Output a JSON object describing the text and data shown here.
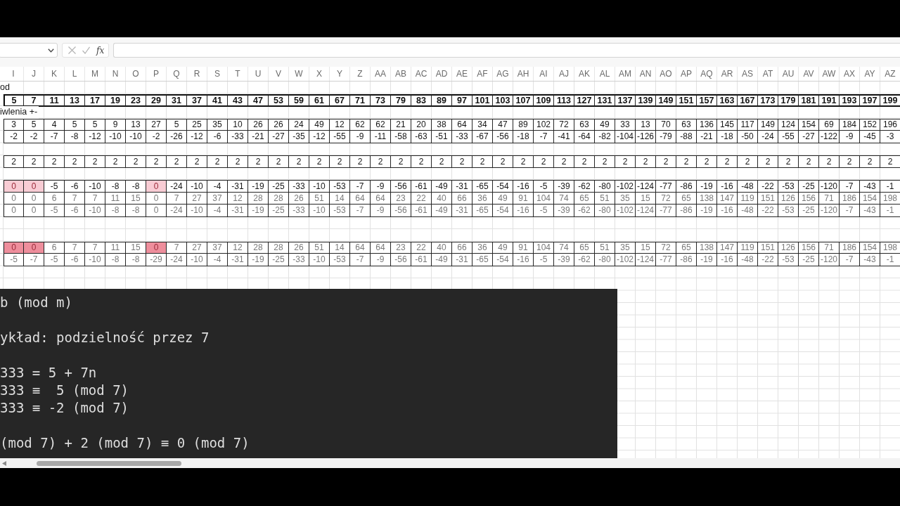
{
  "formula_bar": {
    "function_label": "fx"
  },
  "columns": [
    "I",
    "J",
    "K",
    "L",
    "M",
    "N",
    "O",
    "P",
    "Q",
    "R",
    "S",
    "T",
    "U",
    "V",
    "W",
    "X",
    "Y",
    "Z",
    "AA",
    "AB",
    "AC",
    "AD",
    "AE",
    "AF",
    "AG",
    "AH",
    "AI",
    "AJ",
    "AK",
    "AL",
    "AM",
    "AN",
    "AO",
    "AP",
    "AQ",
    "AR",
    "AS",
    "AT",
    "AU",
    "AV",
    "AW",
    "AX",
    "AY",
    "AZ"
  ],
  "rows": [
    {
      "kind": "label",
      "text": "od"
    },
    {
      "kind": "header",
      "cells": [
        "5",
        "7",
        "11",
        "13",
        "17",
        "19",
        "23",
        "29",
        "31",
        "37",
        "41",
        "43",
        "47",
        "53",
        "59",
        "61",
        "67",
        "71",
        "73",
        "79",
        "83",
        "89",
        "97",
        "101",
        "103",
        "107",
        "109",
        "113",
        "127",
        "131",
        "137",
        "139",
        "149",
        "151",
        "157",
        "163",
        "167",
        "173",
        "179",
        "181",
        "191",
        "193",
        "197",
        "199"
      ]
    },
    {
      "kind": "label",
      "text": "iwlenia +-"
    },
    {
      "kind": "values",
      "cells": [
        "3",
        "5",
        "4",
        "5",
        "5",
        "9",
        "13",
        "27",
        "5",
        "25",
        "35",
        "10",
        "26",
        "26",
        "24",
        "49",
        "12",
        "62",
        "62",
        "21",
        "20",
        "38",
        "64",
        "34",
        "47",
        "89",
        "102",
        "72",
        "63",
        "49",
        "33",
        "13",
        "70",
        "63",
        "136",
        "145",
        "117",
        "149",
        "124",
        "154",
        "69",
        "184",
        "152",
        "196"
      ]
    },
    {
      "kind": "values",
      "cells": [
        "-2",
        "-2",
        "-7",
        "-8",
        "-12",
        "-10",
        "-10",
        "-2",
        "-26",
        "-12",
        "-6",
        "-33",
        "-21",
        "-27",
        "-35",
        "-12",
        "-55",
        "-9",
        "-11",
        "-58",
        "-63",
        "-51",
        "-33",
        "-67",
        "-56",
        "-18",
        "-7",
        "-41",
        "-64",
        "-82",
        "-104",
        "-126",
        "-79",
        "-88",
        "-21",
        "-18",
        "-50",
        "-24",
        "-55",
        "-27",
        "-122",
        "-9",
        "-45",
        "-3"
      ]
    },
    {
      "kind": "blank"
    },
    {
      "kind": "values",
      "cells": [
        "2",
        "2",
        "2",
        "2",
        "2",
        "2",
        "2",
        "2",
        "2",
        "2",
        "2",
        "2",
        "2",
        "2",
        "2",
        "2",
        "2",
        "2",
        "2",
        "2",
        "2",
        "2",
        "2",
        "2",
        "2",
        "2",
        "2",
        "2",
        "2",
        "2",
        "2",
        "2",
        "2",
        "2",
        "2",
        "2",
        "2",
        "2",
        "2",
        "2",
        "2",
        "2",
        "2",
        "2"
      ]
    },
    {
      "kind": "blank"
    },
    {
      "kind": "values",
      "color": "#f8ccd4",
      "cells": [
        {
          "value": "0",
          "highlighted": true
        },
        {
          "value": "0",
          "highlighted": true
        },
        {
          "value": "-5",
          "highlighted": false
        },
        {
          "value": "-6",
          "highlighted": false
        },
        {
          "value": "-10",
          "highlighted": false
        },
        {
          "value": "-8",
          "highlighted": false
        },
        {
          "value": "-8",
          "highlighted": false
        },
        {
          "value": "0",
          "highlighted": true
        },
        {
          "value": "-24",
          "highlighted": false
        },
        {
          "value": "-10",
          "highlighted": false
        },
        {
          "value": "-4",
          "highlighted": false
        },
        {
          "value": "-31",
          "highlighted": false
        },
        {
          "value": "-19",
          "highlighted": false
        },
        {
          "value": "-25",
          "highlighted": false
        },
        {
          "value": "-33",
          "highlighted": false
        },
        {
          "value": "-10",
          "highlighted": false
        },
        {
          "value": "-53",
          "highlighted": false
        },
        {
          "value": "-7",
          "highlighted": false
        },
        {
          "value": "-9",
          "highlighted": false
        },
        {
          "value": "-56",
          "highlighted": false
        },
        {
          "value": "-61",
          "highlighted": false
        },
        {
          "value": "-49",
          "highlighted": false
        },
        {
          "value": "-31",
          "highlighted": false
        },
        {
          "value": "-65",
          "highlighted": false
        },
        {
          "value": "-54",
          "highlighted": false
        },
        {
          "value": "-16",
          "highlighted": false
        },
        {
          "value": "-5",
          "highlighted": false
        },
        {
          "value": "-39",
          "highlighted": false
        },
        {
          "value": "-62",
          "highlighted": false
        },
        {
          "value": "-80",
          "highlighted": false
        },
        {
          "value": "-102",
          "highlighted": false
        },
        {
          "value": "-124",
          "highlighted": false
        },
        {
          "value": "-77",
          "highlighted": false
        },
        {
          "value": "-86",
          "highlighted": false
        },
        {
          "value": "-19",
          "highlighted": false
        },
        {
          "value": "-16",
          "highlighted": false
        },
        {
          "value": "-48",
          "highlighted": false
        },
        {
          "value": "-22",
          "highlighted": false
        },
        {
          "value": "-53",
          "highlighted": false
        },
        {
          "value": "-25",
          "highlighted": false
        },
        {
          "value": "-120",
          "highlighted": false
        },
        {
          "value": "-7",
          "highlighted": false
        },
        {
          "value": "-43",
          "highlighted": false
        },
        {
          "value": "-1",
          "highlighted": false
        }
      ]
    },
    {
      "kind": "derived",
      "cells": [
        "0",
        "0",
        "6",
        "7",
        "7",
        "11",
        "15",
        "0",
        "7",
        "27",
        "37",
        "12",
        "28",
        "28",
        "26",
        "51",
        "14",
        "64",
        "64",
        "23",
        "22",
        "40",
        "66",
        "36",
        "49",
        "91",
        "104",
        "74",
        "65",
        "51",
        "35",
        "15",
        "72",
        "65",
        "138",
        "147",
        "119",
        "151",
        "126",
        "156",
        "71",
        "186",
        "154",
        "198"
      ]
    },
    {
      "kind": "derived",
      "cells": [
        "0",
        "0",
        "-5",
        "-6",
        "-10",
        "-8",
        "-8",
        "0",
        "-24",
        "-10",
        "-4",
        "-31",
        "-19",
        "-25",
        "-33",
        "-10",
        "-53",
        "-7",
        "-9",
        "-56",
        "-61",
        "-49",
        "-31",
        "-65",
        "-54",
        "-16",
        "-5",
        "-39",
        "-62",
        "-80",
        "-102",
        "-124",
        "-77",
        "-86",
        "-19",
        "-16",
        "-48",
        "-22",
        "-53",
        "-25",
        "-120",
        "-7",
        "-43",
        "-1"
      ]
    },
    {
      "kind": "blank"
    },
    {
      "kind": "blank"
    },
    {
      "kind": "derived",
      "color": "#ee8e9c",
      "cells": [
        {
          "value": "0",
          "highlighted": true
        },
        {
          "value": "0",
          "highlighted": true
        },
        {
          "value": "6",
          "highlighted": false
        },
        {
          "value": "7",
          "highlighted": false
        },
        {
          "value": "7",
          "highlighted": false
        },
        {
          "value": "11",
          "highlighted": false
        },
        {
          "value": "15",
          "highlighted": false
        },
        {
          "value": "0",
          "highlighted": true
        },
        {
          "value": "7",
          "highlighted": false
        },
        {
          "value": "27",
          "highlighted": false
        },
        {
          "value": "37",
          "highlighted": false
        },
        {
          "value": "12",
          "highlighted": false
        },
        {
          "value": "28",
          "highlighted": false
        },
        {
          "value": "28",
          "highlighted": false
        },
        {
          "value": "26",
          "highlighted": false
        },
        {
          "value": "51",
          "highlighted": false
        },
        {
          "value": "14",
          "highlighted": false
        },
        {
          "value": "64",
          "highlighted": false
        },
        {
          "value": "64",
          "highlighted": false
        },
        {
          "value": "23",
          "highlighted": false
        },
        {
          "value": "22",
          "highlighted": false
        },
        {
          "value": "40",
          "highlighted": false
        },
        {
          "value": "66",
          "highlighted": false
        },
        {
          "value": "36",
          "highlighted": false
        },
        {
          "value": "49",
          "highlighted": false
        },
        {
          "value": "91",
          "highlighted": false
        },
        {
          "value": "104",
          "highlighted": false
        },
        {
          "value": "74",
          "highlighted": false
        },
        {
          "value": "65",
          "highlighted": false
        },
        {
          "value": "51",
          "highlighted": false
        },
        {
          "value": "35",
          "highlighted": false
        },
        {
          "value": "15",
          "highlighted": false
        },
        {
          "value": "72",
          "highlighted": false
        },
        {
          "value": "65",
          "highlighted": false
        },
        {
          "value": "138",
          "highlighted": false
        },
        {
          "value": "147",
          "highlighted": false
        },
        {
          "value": "119",
          "highlighted": false
        },
        {
          "value": "151",
          "highlighted": false
        },
        {
          "value": "126",
          "highlighted": false
        },
        {
          "value": "156",
          "highlighted": false
        },
        {
          "value": "71",
          "highlighted": false
        },
        {
          "value": "186",
          "highlighted": false
        },
        {
          "value": "154",
          "highlighted": false
        },
        {
          "value": "198",
          "highlighted": false
        }
      ]
    },
    {
      "kind": "derived",
      "cells": [
        "-5",
        "-7",
        "-5",
        "-6",
        "-10",
        "-8",
        "-8",
        "-29",
        "-24",
        "-10",
        "-4",
        "-31",
        "-19",
        "-25",
        "-33",
        "-10",
        "-53",
        "-7",
        "-9",
        "-56",
        "-61",
        "-49",
        "-31",
        "-65",
        "-54",
        "-16",
        "-5",
        "-39",
        "-62",
        "-80",
        "-102",
        "-124",
        "-77",
        "-86",
        "-19",
        "-16",
        "-48",
        "-22",
        "-53",
        "-25",
        "-120",
        "-7",
        "-43",
        "-1"
      ]
    }
  ],
  "text_panel": {
    "blocks": [
      [
        "b (mod m)"
      ],
      [
        "ykład: podzielność przez 7"
      ],
      [
        "333 = 5 + 7n",
        "333 ≡  5 (mod 7)",
        "333 ≡ -2 (mod 7)"
      ],
      [
        "(mod 7) + 2 (mod 7) ≡ 0 (mod 7)"
      ]
    ]
  }
}
